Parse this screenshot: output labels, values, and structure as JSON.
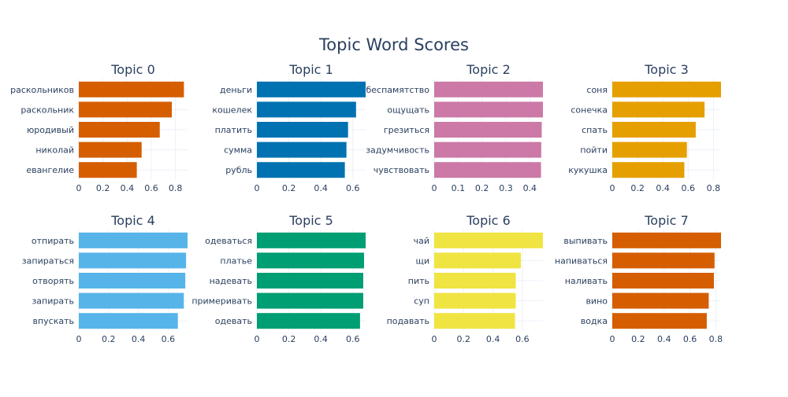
{
  "chart_data": {
    "type": "bar",
    "orientation": "horizontal",
    "title": "Topic Word Scores",
    "layout": "2 rows x 4 columns",
    "grid": true,
    "subplots": [
      {
        "title": "Topic 0",
        "color": "#D55E00",
        "categories": [
          "раскольников",
          "раскольник",
          "юродивый",
          "николай",
          "евангелие"
        ],
        "values": [
          0.87,
          0.77,
          0.67,
          0.52,
          0.48
        ],
        "xlim": [
          0,
          0.9
        ],
        "xticks": [
          0,
          0.2,
          0.4,
          0.6,
          0.8
        ],
        "xtick_labels": [
          "0",
          "0.2",
          "0.4",
          "0.6",
          "0.8"
        ]
      },
      {
        "title": "Topic 1",
        "color": "#0072B2",
        "categories": [
          "деньги",
          "кошелек",
          "платить",
          "сумма",
          "рубль"
        ],
        "values": [
          0.68,
          0.62,
          0.57,
          0.56,
          0.55
        ],
        "xlim": [
          0,
          0.68
        ],
        "xticks": [
          0,
          0.2,
          0.4,
          0.6
        ],
        "xtick_labels": [
          "0",
          "0.2",
          "0.4",
          "0.6"
        ]
      },
      {
        "title": "Topic 2",
        "color": "#CC79A7",
        "categories": [
          "беспамятство",
          "ощущать",
          "грезиться",
          "задумчивость",
          "чувствовать"
        ],
        "values": [
          0.455,
          0.455,
          0.45,
          0.448,
          0.447
        ],
        "xlim": [
          0,
          0.455
        ],
        "xticks": [
          0,
          0.1,
          0.2,
          0.3,
          0.4
        ],
        "xtick_labels": [
          "0",
          "0.1",
          "0.2",
          "0.3",
          "0.4"
        ]
      },
      {
        "title": "Topic 3",
        "color": "#E69F00",
        "categories": [
          "соня",
          "сонечка",
          "спать",
          "пойти",
          "кукушка"
        ],
        "values": [
          0.86,
          0.73,
          0.66,
          0.59,
          0.57
        ],
        "xlim": [
          0,
          0.86
        ],
        "xticks": [
          0,
          0.2,
          0.4,
          0.6,
          0.8
        ],
        "xtick_labels": [
          "0",
          "0.2",
          "0.4",
          "0.6",
          "0.8"
        ]
      },
      {
        "title": "Topic 4",
        "color": "#56B4E9",
        "categories": [
          "отпирать",
          "запираться",
          "отворять",
          "запирать",
          "впускать"
        ],
        "values": [
          0.73,
          0.72,
          0.715,
          0.705,
          0.665
        ],
        "xlim": [
          0,
          0.73
        ],
        "xticks": [
          0,
          0.2,
          0.4,
          0.6
        ],
        "xtick_labels": [
          "0",
          "0.2",
          "0.4",
          "0.6"
        ]
      },
      {
        "title": "Topic 5",
        "color": "#009E73",
        "categories": [
          "одеваться",
          "платье",
          "надевать",
          "примеривать",
          "одевать"
        ],
        "values": [
          0.68,
          0.67,
          0.665,
          0.665,
          0.645
        ],
        "xlim": [
          0,
          0.68
        ],
        "xticks": [
          0,
          0.2,
          0.4,
          0.6
        ],
        "xtick_labels": [
          "0",
          "0.2",
          "0.4",
          "0.6"
        ]
      },
      {
        "title": "Topic 6",
        "color": "#F0E442",
        "categories": [
          "чай",
          "щи",
          "пить",
          "суп",
          "подавать"
        ],
        "values": [
          0.74,
          0.59,
          0.555,
          0.555,
          0.55
        ],
        "xlim": [
          0,
          0.74
        ],
        "xticks": [
          0,
          0.2,
          0.4,
          0.6
        ],
        "xtick_labels": [
          "0",
          "0.2",
          "0.4",
          "0.6"
        ]
      },
      {
        "title": "Topic 7",
        "color": "#D55E00",
        "categories": [
          "выпивать",
          "напиваться",
          "наливать",
          "вино",
          "водка"
        ],
        "values": [
          0.84,
          0.79,
          0.785,
          0.745,
          0.73
        ],
        "xlim": [
          0,
          0.84
        ],
        "xticks": [
          0,
          0.2,
          0.4,
          0.6,
          0.8
        ],
        "xtick_labels": [
          "0",
          "0.2",
          "0.4",
          "0.6",
          "0.8"
        ]
      }
    ]
  }
}
